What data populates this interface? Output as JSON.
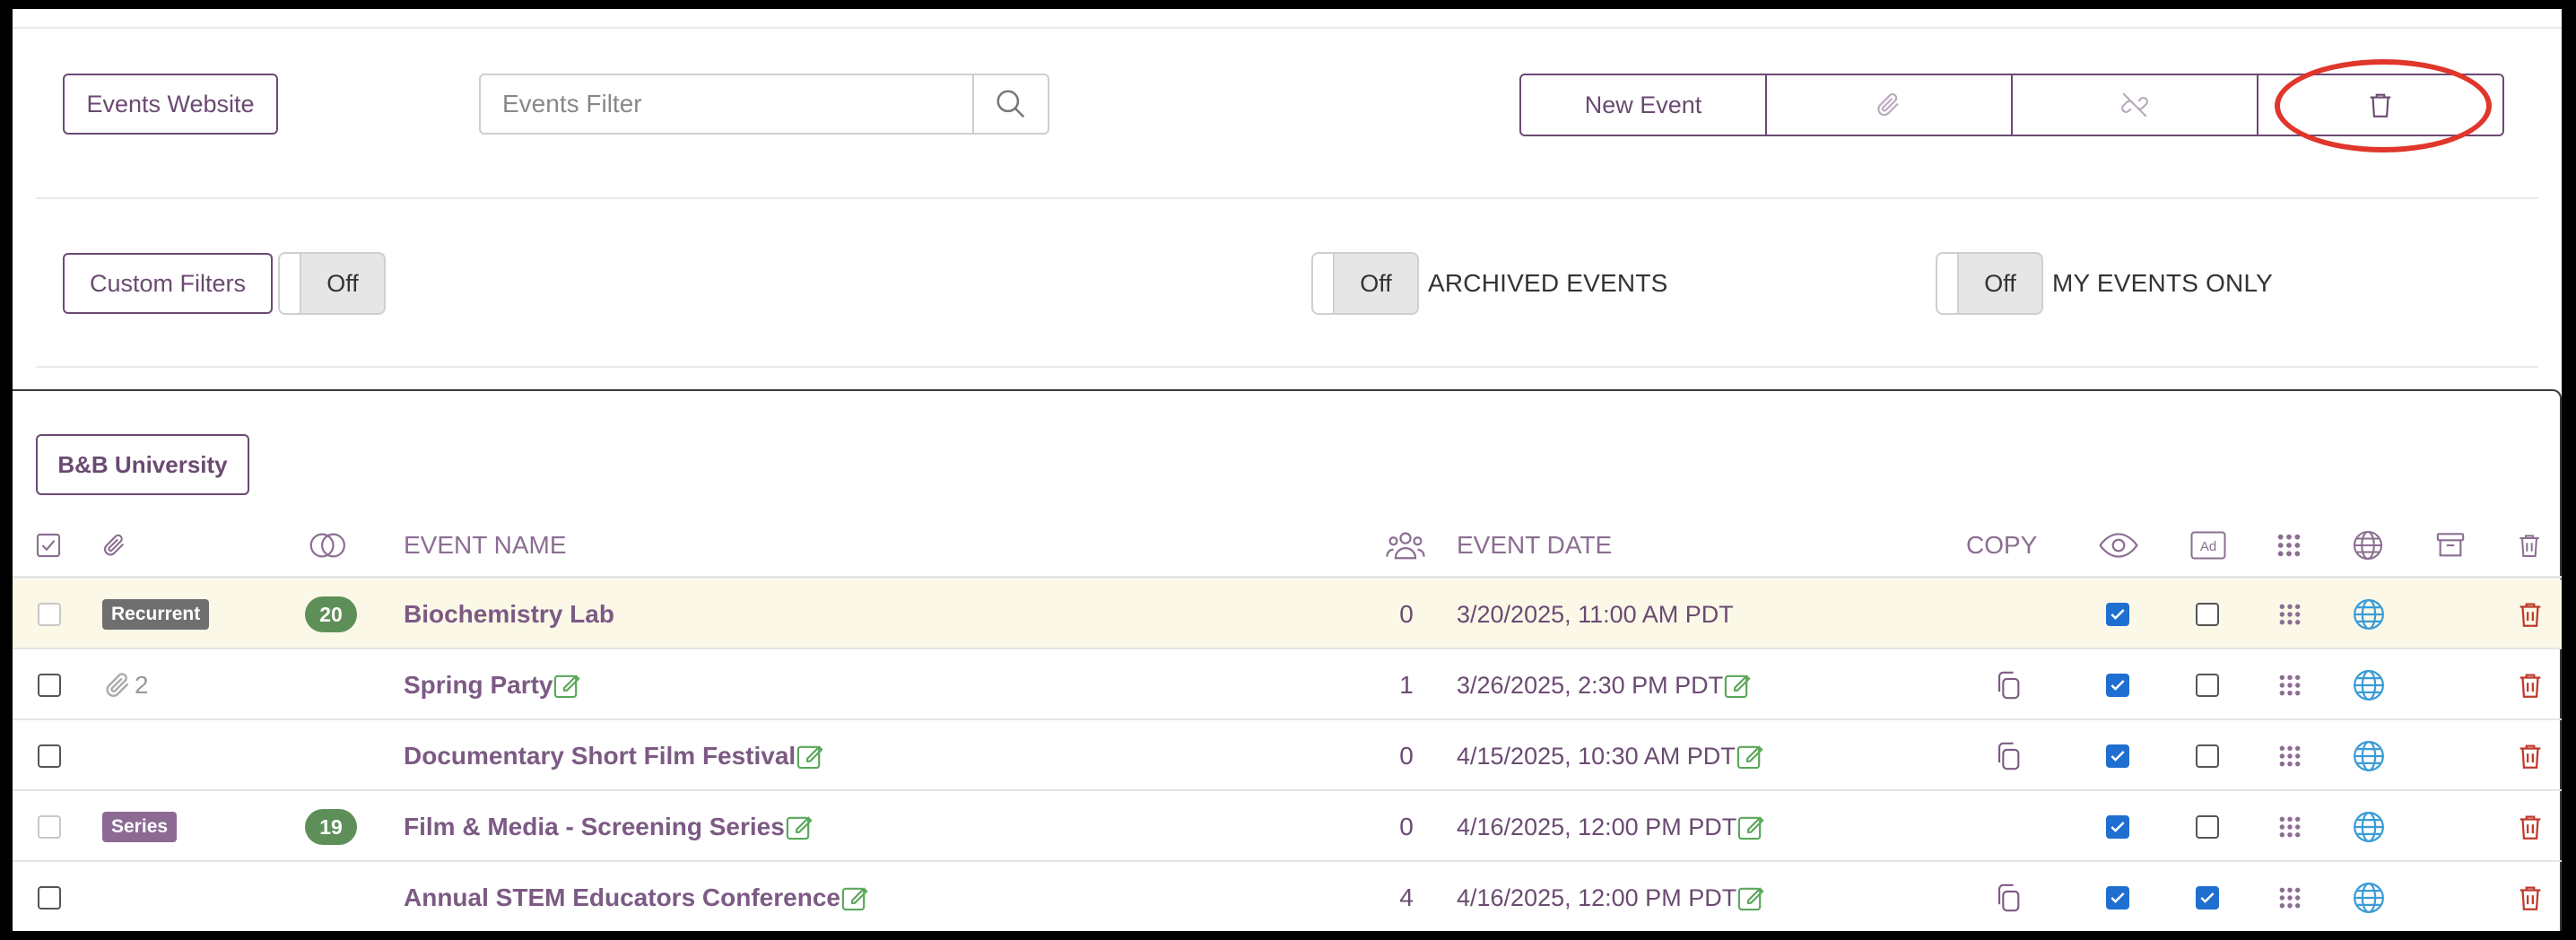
{
  "toolbar": {
    "events_website_label": "Events Website",
    "filter_placeholder": "Events Filter",
    "new_event_label": "New Event"
  },
  "filters": {
    "custom_filters_label": "Custom Filters",
    "custom_filters_state": "Off",
    "archived_state": "Off",
    "archived_label": "ARCHIVED EVENTS",
    "my_events_state": "Off",
    "my_events_label": "MY EVENTS ONLY"
  },
  "list": {
    "organization_label": "B&B University",
    "headers": {
      "event_name": "EVENT NAME",
      "event_date": "EVENT DATE",
      "copy": "COPY"
    },
    "rows": [
      {
        "selectable": false,
        "tag": "Recurrent",
        "tag_type": "recurrent",
        "attachments": "",
        "count_badge": "20",
        "name": "Biochemistry Lab",
        "name_editable": false,
        "attendees": "0",
        "date": "3/20/2025, 11:00 AM PDT",
        "date_editable": false,
        "copyable": false,
        "visible": true,
        "ad": false,
        "highlighted": true
      },
      {
        "selectable": true,
        "tag": "",
        "tag_type": "",
        "attachments": "2",
        "count_badge": "",
        "name": "Spring Party",
        "name_editable": true,
        "attendees": "1",
        "date": "3/26/2025, 2:30 PM PDT",
        "date_editable": true,
        "copyable": true,
        "visible": true,
        "ad": false,
        "highlighted": false
      },
      {
        "selectable": true,
        "tag": "",
        "tag_type": "",
        "attachments": "",
        "count_badge": "",
        "name": "Documentary Short Film Festival",
        "name_editable": true,
        "attendees": "0",
        "date": "4/15/2025, 10:30 AM PDT",
        "date_editable": true,
        "copyable": true,
        "visible": true,
        "ad": false,
        "highlighted": false
      },
      {
        "selectable": false,
        "tag": "Series",
        "tag_type": "series",
        "attachments": "",
        "count_badge": "19",
        "name": "Film & Media - Screening Series",
        "name_editable": true,
        "attendees": "0",
        "date": "4/16/2025, 12:00 PM PDT",
        "date_editable": true,
        "copyable": false,
        "visible": true,
        "ad": false,
        "highlighted": false
      },
      {
        "selectable": true,
        "tag": "",
        "tag_type": "",
        "attachments": "",
        "count_badge": "",
        "name": "Annual STEM Educators Conference",
        "name_editable": true,
        "attendees": "4",
        "date": "4/16/2025, 12:00 PM PDT",
        "date_editable": true,
        "copyable": true,
        "visible": true,
        "ad": true,
        "highlighted": false
      }
    ]
  },
  "icons": {
    "search": "search-icon",
    "attach": "paperclip-icon",
    "unlink": "unlink-icon",
    "trash": "trash-icon",
    "attendees": "people-icon",
    "visibility": "eye-icon",
    "ad": "ad-icon",
    "grid": "grid-dots-icon",
    "globe": "globe-icon",
    "archive": "archive-icon",
    "copy": "copy-icon",
    "edit": "edit-icon"
  },
  "colors": {
    "brand": "#6b4a72",
    "annotation": "#e0362b",
    "delete": "#c0392b",
    "globe": "#3a9bd6",
    "badge_green": "#5e8f58",
    "edit_green": "#5aa85a",
    "checkbox_blue": "#1f6fd1"
  }
}
